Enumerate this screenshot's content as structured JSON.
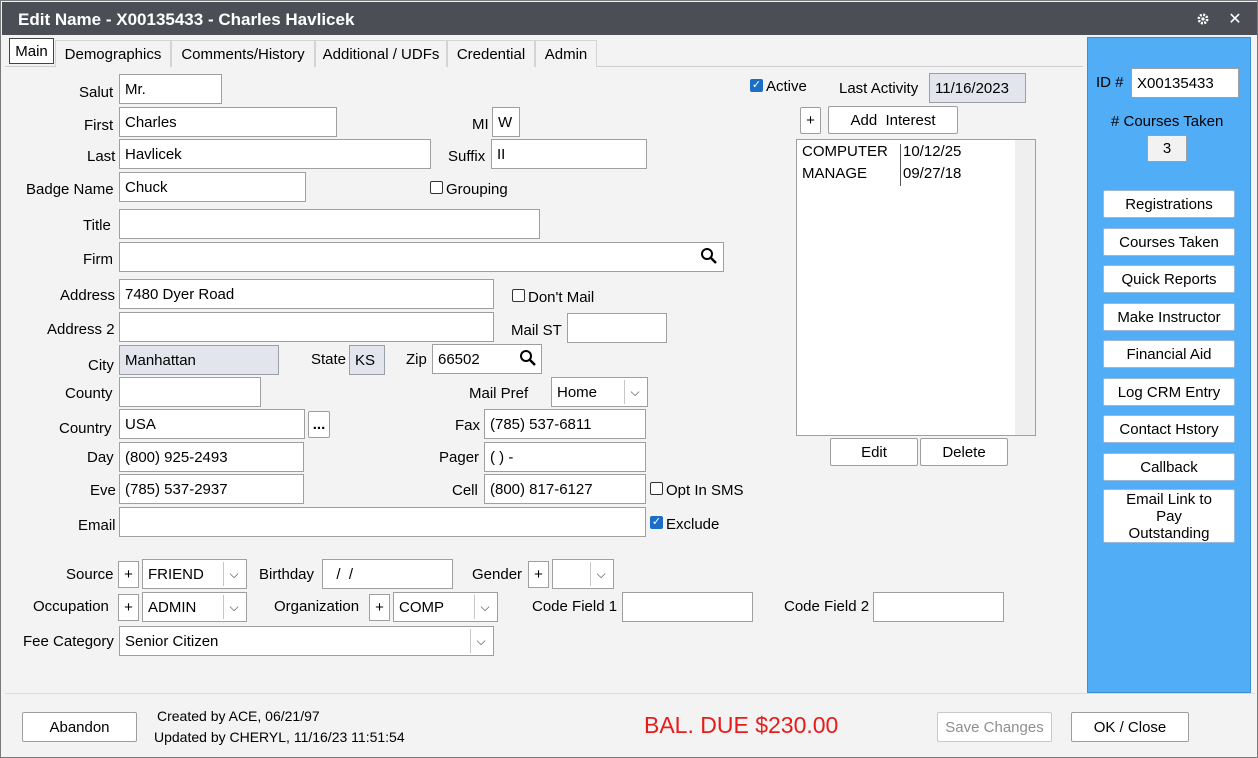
{
  "window": {
    "title": "Edit Name - X00135433 - Charles Havlicek",
    "gear_icon": "gear-icon",
    "close_label": "✕"
  },
  "tabs": [
    {
      "label": "Main",
      "active": true
    },
    {
      "label": "Demographics"
    },
    {
      "label": "Comments/History"
    },
    {
      "label": "Additional / UDFs"
    },
    {
      "label": "Credential"
    },
    {
      "label": "Admin"
    }
  ],
  "labels": {
    "salut": "Salut",
    "first": "First",
    "mi": "MI",
    "last": "Last",
    "suffix": "Suffix",
    "badge_name": "Badge Name",
    "grouping": "Grouping",
    "title": "Title",
    "firm": "Firm",
    "address": "Address",
    "dont_mail": "Don't Mail",
    "address2": "Address 2",
    "mail_st": "Mail ST",
    "city": "City",
    "state": "State",
    "zip": "Zip",
    "county": "County",
    "mail_pref": "Mail Pref",
    "country": "Country",
    "fax": "Fax",
    "day": "Day",
    "pager": "Pager",
    "eve": "Eve",
    "cell": "Cell",
    "opt_in_sms": "Opt In SMS",
    "email": "Email",
    "exclude": "Exclude",
    "source": "Source",
    "birthday": "Birthday",
    "gender": "Gender",
    "occupation": "Occupation",
    "organization": "Organization",
    "code_field_1": "Code Field 1",
    "code_field_2": "Code Field 2",
    "fee_category": "Fee Category",
    "active": "Active",
    "last_activity": "Last Activity"
  },
  "values": {
    "salut": "Mr.",
    "first": "Charles",
    "mi": "W",
    "last": "Havlicek",
    "suffix": "II",
    "badge_name": "Chuck",
    "title": "",
    "firm": "",
    "address": "7480 Dyer Road",
    "address2": "",
    "mail_st": "",
    "city": "Manhattan",
    "state": "KS",
    "zip": "66502",
    "county": "",
    "mail_pref": "Home",
    "country": "USA",
    "country_more": "...",
    "fax": "(785) 537-6811",
    "day": "(800) 925-2493",
    "pager": "(   )   -",
    "eve": "(785) 537-2937",
    "cell": "(800) 817-6127",
    "email": "",
    "source": "FRIEND",
    "birthday": "  /  /",
    "gender": "",
    "occupation": "ADMIN",
    "organization": "COMP",
    "code_field_1": "",
    "code_field_2": "",
    "fee_category": "Senior Citizen",
    "last_activity": "11/16/2023"
  },
  "checks": {
    "active": true,
    "grouping": false,
    "dont_mail": false,
    "opt_in_sms": false,
    "exclude": true
  },
  "interests": {
    "add_plus": "+",
    "add_label": "Add  Interest",
    "rows": [
      {
        "name": "COMPUTER",
        "date": "10/12/25"
      },
      {
        "name": "MANAGE",
        "date": "09/27/18"
      }
    ],
    "edit_label": "Edit",
    "delete_label": "Delete"
  },
  "plus_label": "+",
  "sidebar": {
    "id_label": "ID #",
    "id_value": "X00135433",
    "courses_taken_label": "# Courses Taken",
    "courses_taken_value": "3",
    "buttons": [
      "Registrations",
      "Courses Taken",
      "Quick Reports",
      "Make Instructor",
      "Financial Aid",
      "Log CRM Entry",
      "Contact Hstory",
      "Callback",
      "Email Link to Pay Outstanding"
    ]
  },
  "footer": {
    "abandon": "Abandon",
    "created": "Created by ACE, 06/21/97",
    "updated": "Updated by CHERYL, 11/16/23 11:51:54",
    "balance_due": "BAL. DUE $230.00",
    "save_changes": "Save Changes",
    "ok_close": "OK / Close"
  },
  "colors": {
    "titlebar": "#4b4f55",
    "sidebar": "#52adf7",
    "balance_due": "#e81b1b",
    "checkbox_checked": "#1a6ec8"
  }
}
